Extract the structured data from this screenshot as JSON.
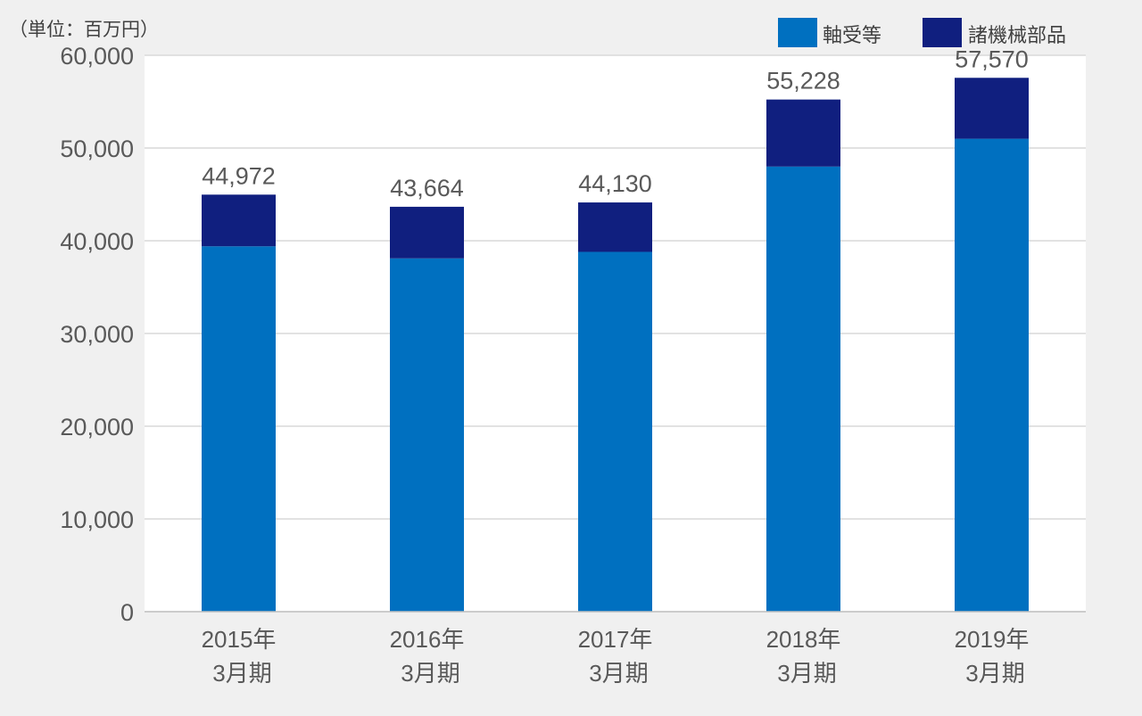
{
  "chart_data": {
    "type": "bar",
    "stacked": true,
    "unit_label": "（単位：百万円）",
    "categories": [
      [
        "2015年",
        "3月期"
      ],
      [
        "2016年",
        "3月期"
      ],
      [
        "2017年",
        "3月期"
      ],
      [
        "2018年",
        "3月期"
      ],
      [
        "2019年",
        "3月期"
      ]
    ],
    "series": [
      {
        "name": "軸受等",
        "color": "#0070c0",
        "values": [
          39400,
          38100,
          38800,
          48000,
          51000
        ]
      },
      {
        "name": "諸機械部品",
        "color": "#101f7f",
        "values": [
          5572,
          5564,
          5330,
          7228,
          6570
        ]
      }
    ],
    "totals": [
      44972,
      43664,
      44130,
      55228,
      57570
    ],
    "total_labels": [
      "44,972",
      "43,664",
      "44,130",
      "55,228",
      "57,570"
    ],
    "ylim": [
      0,
      60000
    ],
    "yticks": [
      0,
      10000,
      20000,
      30000,
      40000,
      50000,
      60000
    ],
    "ytick_labels": [
      "0",
      "10,000",
      "20,000",
      "30,000",
      "40,000",
      "50,000",
      "60,000"
    ],
    "grid": true,
    "legend_position": "top-right"
  }
}
